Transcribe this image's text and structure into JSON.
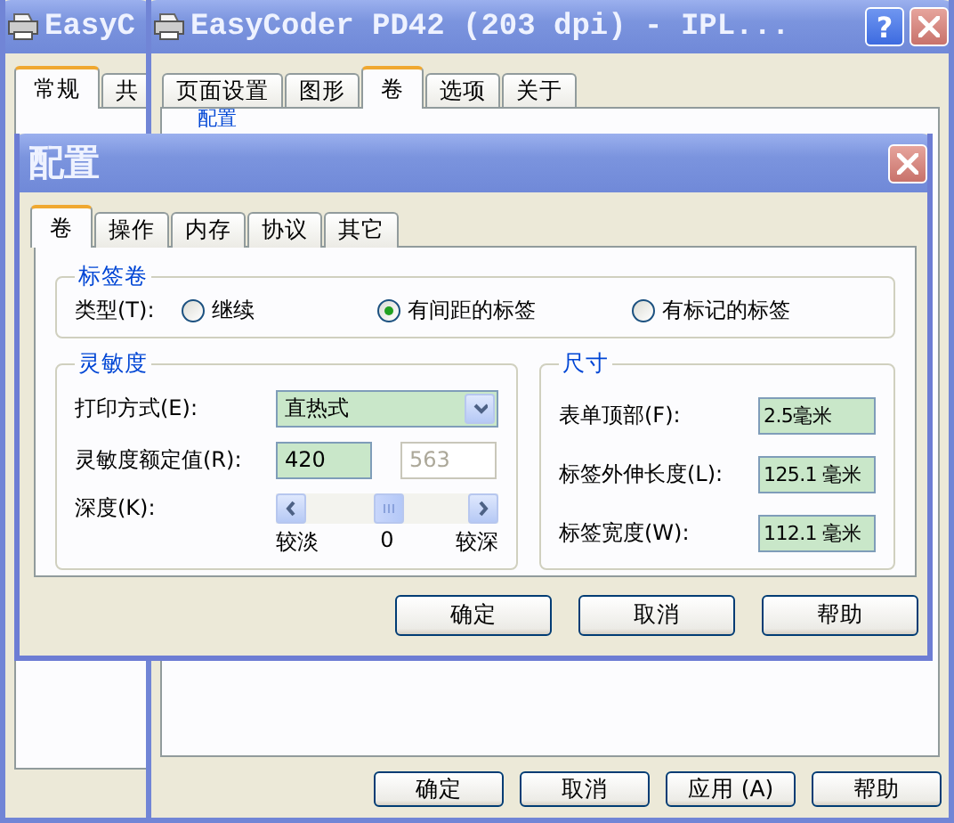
{
  "back_window": {
    "title": "EasyC",
    "tabs": [
      {
        "label": "常规",
        "selected": true
      },
      {
        "label": "共",
        "selected": false
      }
    ]
  },
  "main_window": {
    "title": "EasyCoder PD42 (203 dpi) - IPL...",
    "help_button": "?",
    "tabs": [
      {
        "label": "页面设置",
        "selected": false
      },
      {
        "label": "图形",
        "selected": false
      },
      {
        "label": "卷",
        "selected": true
      },
      {
        "label": "选项",
        "selected": false
      },
      {
        "label": "关于",
        "selected": false
      }
    ],
    "group_title": "配置",
    "buttons": [
      "确定",
      "取消",
      "应用 (A)",
      "帮助"
    ]
  },
  "dialog": {
    "title": "配置",
    "tabs": [
      {
        "label": "卷",
        "selected": true
      },
      {
        "label": "操作",
        "selected": false
      },
      {
        "label": "内存",
        "selected": false
      },
      {
        "label": "协议",
        "selected": false
      },
      {
        "label": "其它",
        "selected": false
      }
    ],
    "label_roll": {
      "title": "标签卷",
      "type_label": "类型(T):",
      "options": [
        {
          "label": "继续",
          "selected": false
        },
        {
          "label": "有间距的标签",
          "selected": true
        },
        {
          "label": "有标记的标签",
          "selected": false
        }
      ]
    },
    "sensitivity": {
      "title": "灵敏度",
      "print_mode_label": "打印方式(E):",
      "print_mode": "直热式",
      "rating_label": "灵敏度额定值(R):",
      "rating_fields": [
        {
          "value": "420",
          "disabled": false
        },
        {
          "value": "563",
          "disabled": true
        }
      ],
      "depth_label": "深度(K):",
      "depth": {
        "level": 0.5
      },
      "depth_min": "较淡",
      "depth_mid": "0",
      "depth_max": "较深"
    },
    "dimensions": {
      "title": "尺寸",
      "rows": [
        {
          "label": "表单顶部(F):",
          "value": "2.5毫米"
        },
        {
          "label": "标签外伸长度(L):",
          "value": "125.1 毫米"
        },
        {
          "label": "标签宽度(W):",
          "value": "112.1 毫米"
        }
      ]
    },
    "buttons": [
      "确定",
      "取消",
      "帮助"
    ]
  }
}
